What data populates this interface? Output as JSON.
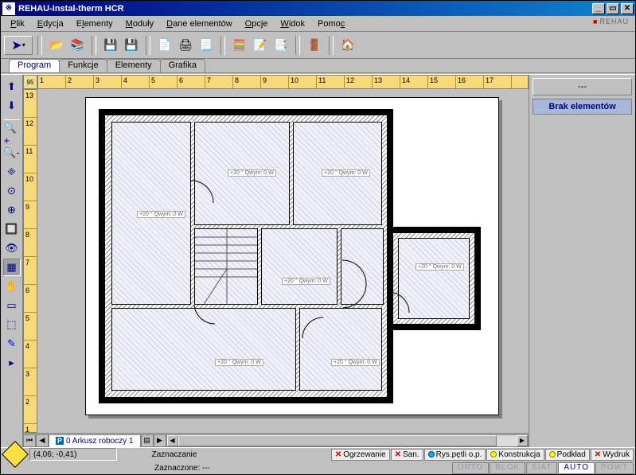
{
  "window": {
    "title": "REHAU-Instal-therm HCR",
    "brand": "REHAU"
  },
  "menu": {
    "items": [
      "Plik",
      "Edycja",
      "Elementy",
      "Moduły",
      "Dane elementów",
      "Opcje",
      "Widok",
      "Pomoc"
    ]
  },
  "tabs": {
    "items": [
      "Program",
      "Funkcje",
      "Elementy",
      "Grafika"
    ],
    "active": 0
  },
  "ruler": {
    "corner": "95",
    "h": [
      "1",
      "2",
      "3",
      "4",
      "5",
      "6",
      "7",
      "8",
      "9",
      "10",
      "11",
      "12",
      "13",
      "14",
      "15",
      "16",
      "17"
    ],
    "v": [
      "13",
      "12",
      "11",
      "10",
      "9",
      "8",
      "7",
      "6",
      "5",
      "4",
      "3",
      "2",
      "1"
    ]
  },
  "rooms": [
    {
      "label": "+20 °\\nQwym: 0 W"
    },
    {
      "label": "+20 °\\nQwym: 0 W"
    },
    {
      "label": "+20 °\\nQwym: 0 W"
    },
    {
      "label": "+20 °\\nQwym: 0 W"
    },
    {
      "label": "+20 °\\nQwym: 0 W"
    },
    {
      "label": "+20 °\\nQwym: 0 W"
    },
    {
      "label": "+20 °\\nQwym: 0 W"
    }
  ],
  "sheet": {
    "name": "0 Arkusz roboczy 1"
  },
  "right": {
    "header": "---",
    "bar": "Brak elementów"
  },
  "status": {
    "coords": "(4,06; -0,41)",
    "mode1": "Zaznaczanie",
    "mode2": "Zaznaczone: ---",
    "layers": [
      {
        "mark": "x",
        "text": "Ogrzewanie"
      },
      {
        "mark": "x",
        "text": "San."
      },
      {
        "mark": "dotb",
        "text": "Rys.pętli o.p."
      },
      {
        "mark": "doty",
        "text": "Konstrukcja"
      },
      {
        "mark": "doty",
        "text": "Podkład"
      },
      {
        "mark": "x",
        "text": "Wydruk"
      }
    ],
    "modes": [
      {
        "text": "ORTO",
        "state": "off"
      },
      {
        "text": "BLOK",
        "state": "off"
      },
      {
        "text": "SIAT",
        "state": "off"
      },
      {
        "text": "AUTO",
        "state": "on"
      },
      {
        "text": "POWT",
        "state": "off"
      }
    ]
  }
}
